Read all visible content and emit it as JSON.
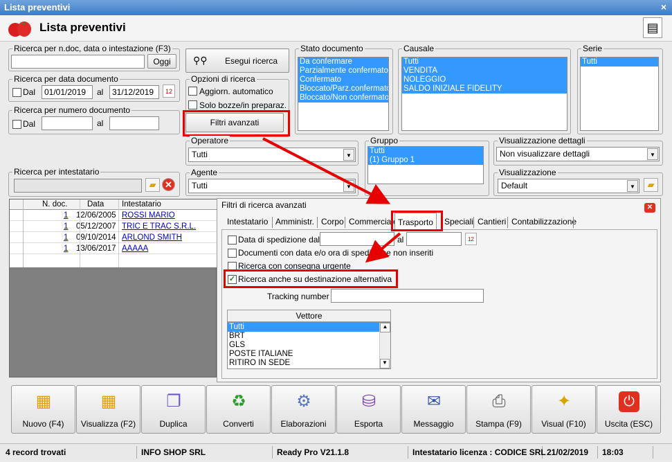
{
  "window": {
    "title": "Lista preventivi",
    "close": "×"
  },
  "header": {
    "title": "Lista preventivi"
  },
  "search_text": {
    "label": "Ricerca per n.doc, data o intestazione (F3)",
    "value": "",
    "button": "Oggi"
  },
  "exec_button": "Esegui ricerca",
  "date_search": {
    "label": "Ricerca per data documento",
    "dal": "Dal",
    "from": "01/01/2019",
    "al": "al",
    "to": "31/12/2019"
  },
  "num_search": {
    "label": "Ricerca per numero documento",
    "dal": "Dal",
    "al": "al",
    "from": "",
    "to": ""
  },
  "options": {
    "label": "Opzioni di ricerca",
    "auto": "Aggiorn. automatico",
    "drafts": "Solo bozze/in preparaz.",
    "advanced": "Filtri avanzati"
  },
  "stato": {
    "label": "Stato documento",
    "items": [
      "Da confermare",
      "Parzialmente confermato",
      "Confermato",
      "Bloccato/Parz.confermato",
      "Bloccato/Non confermato"
    ]
  },
  "causale": {
    "label": "Causale",
    "items": [
      "Tutti",
      "VENDITA",
      "NOLEGGIO",
      "SALDO INIZIALE FIDELITY"
    ]
  },
  "serie": {
    "label": "Serie",
    "items": [
      "Tutti"
    ]
  },
  "operatore": {
    "label": "Operatore",
    "value": "Tutti"
  },
  "agente": {
    "label": "Agente",
    "value": "Tutti"
  },
  "gruppo": {
    "label": "Gruppo",
    "items": [
      "Tutti",
      "(1) Gruppo 1"
    ]
  },
  "vis_dettagli": {
    "label": "Visualizzazione dettagli",
    "value": "Non visualizzare dettagli"
  },
  "visualizzazione": {
    "label": "Visualizzazione",
    "value": "Default"
  },
  "intestatario": {
    "label": "Ricerca per intestatario",
    "value": ""
  },
  "grid": {
    "columns": [
      "N. doc.",
      "Data",
      "Intestatario"
    ],
    "rows": [
      {
        "num": "1",
        "date": "12/06/2005",
        "name": "ROSSI MARIO"
      },
      {
        "num": "1",
        "date": "05/12/2007",
        "name": "TRIC E TRAC S.R.L."
      },
      {
        "num": "1",
        "date": "09/10/2014",
        "name": "ARLOND SMITH"
      },
      {
        "num": "1",
        "date": "13/06/2017",
        "name": "AAAAA"
      }
    ]
  },
  "adv": {
    "title": "Filtri di ricerca avanzati",
    "tabs": [
      "Intestatario",
      "Amministr.",
      "Corpo",
      "Commerciale",
      "Trasporto",
      "Speciali",
      "Cantieri",
      "Contabilizzazione"
    ],
    "ship_date": "Data di spedizione dal",
    "ship_al": "al",
    "ship_from": "",
    "ship_to": "",
    "no_date": "Documenti con data e/o ora di spedizione non inseriti",
    "urgent": "Ricerca con consegna urgente",
    "alt_dest": "Ricerca anche su destinazione alternativa",
    "tracking": "Tracking number :",
    "tracking_value": "",
    "vettore": {
      "header": "Vettore",
      "items": [
        "Tutti",
        "BRT",
        "GLS",
        "POSTE ITALIANE",
        "RITIRO IN SEDE"
      ]
    }
  },
  "toolbar": [
    {
      "label": "Nuovo (F4)",
      "icon": "new-doc-icon",
      "glyph": "▦"
    },
    {
      "label": "Visualizza (F2)",
      "icon": "view-icon",
      "glyph": "▦"
    },
    {
      "label": "Duplica",
      "icon": "duplicate-icon",
      "glyph": "❐"
    },
    {
      "label": "Converti",
      "icon": "convert-icon",
      "glyph": "♻"
    },
    {
      "label": "Elaborazioni",
      "icon": "process-icon",
      "glyph": "⚙"
    },
    {
      "label": "Esporta",
      "icon": "export-icon",
      "glyph": "⛁"
    },
    {
      "label": "Messaggio",
      "icon": "message-icon",
      "glyph": "✉"
    },
    {
      "label": "Stampa (F9)",
      "icon": "print-icon",
      "glyph": "⎙"
    },
    {
      "label": "Visual (F10)",
      "icon": "wand-icon",
      "glyph": "✦"
    },
    {
      "label": "Uscita (ESC)",
      "icon": "exit-icon",
      "glyph": "⏻"
    }
  ],
  "status": {
    "records": "4 record trovati",
    "company": "INFO SHOP SRL",
    "version": "Ready Pro V21.1.8",
    "license": "Intestatario licenza : CODICE SRL",
    "date": "21/02/2019",
    "time": "18:03"
  },
  "colors": {
    "selection": "#3399ff",
    "highlight": "#e60000",
    "title": "#4a86cf"
  }
}
